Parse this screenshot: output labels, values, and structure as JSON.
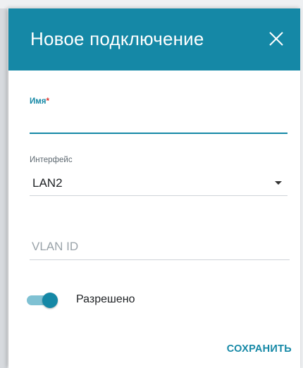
{
  "dialog": {
    "title": "Новое подключение",
    "close_icon": "close-icon"
  },
  "form": {
    "name": {
      "label": "Имя",
      "required_mark": "*",
      "value": ""
    },
    "interface": {
      "label": "Интерфейс",
      "selected": "LAN2"
    },
    "vlan_id": {
      "placeholder": "VLAN ID",
      "value": ""
    },
    "enabled": {
      "label": "Разрешено",
      "state": true
    }
  },
  "actions": {
    "save_label": "СОХРАНИТЬ"
  },
  "colors": {
    "accent": "#1588a6",
    "required": "#d9312c",
    "toggle_track": "#7fc1d3"
  }
}
